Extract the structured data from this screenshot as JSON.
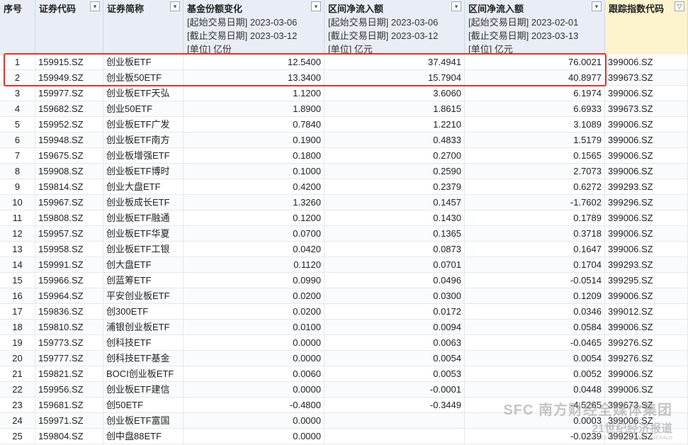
{
  "headers": [
    {
      "title": "序号",
      "lines": [],
      "filter": false,
      "highlight": false
    },
    {
      "title": "证券代码",
      "lines": [],
      "filter": true,
      "highlight": false
    },
    {
      "title": "证券简称",
      "lines": [],
      "filter": true,
      "highlight": false
    },
    {
      "title": "基金份额变化",
      "lines": [
        "[起始交易日期] 2023-03-06",
        "[截止交易日期] 2023-03-12",
        "[单位] 亿份"
      ],
      "filter": true,
      "highlight": false
    },
    {
      "title": "区间净流入额",
      "lines": [
        "[起始交易日期] 2023-03-06",
        "[截止交易日期] 2023-03-12",
        "[单位] 亿元"
      ],
      "filter": true,
      "highlight": false
    },
    {
      "title": "区间净流入额",
      "lines": [
        "[起始交易日期] 2023-02-01",
        "[截止交易日期] 2023-03-13",
        "[单位] 亿元"
      ],
      "filter": true,
      "highlight": false
    },
    {
      "title": "跟踪指数代码",
      "lines": [],
      "filter": true,
      "highlight": true
    }
  ],
  "rows": [
    [
      "1",
      "159915.SZ",
      "创业板ETF",
      "12.5400",
      "37.4941",
      "76.0021",
      "399006.SZ"
    ],
    [
      "2",
      "159949.SZ",
      "创业板50ETF",
      "13.3400",
      "15.7904",
      "40.8977",
      "399673.SZ"
    ],
    [
      "3",
      "159977.SZ",
      "创业板ETF天弘",
      "1.1200",
      "3.6060",
      "6.1974",
      "399006.SZ"
    ],
    [
      "4",
      "159682.SZ",
      "创业50ETF",
      "1.8900",
      "1.8615",
      "6.6933",
      "399673.SZ"
    ],
    [
      "5",
      "159952.SZ",
      "创业板ETF广发",
      "0.7840",
      "1.2210",
      "3.1089",
      "399006.SZ"
    ],
    [
      "6",
      "159948.SZ",
      "创业板ETF南方",
      "0.1900",
      "0.4833",
      "1.5179",
      "399006.SZ"
    ],
    [
      "7",
      "159675.SZ",
      "创业板增强ETF",
      "0.1800",
      "0.2700",
      "0.1565",
      "399006.SZ"
    ],
    [
      "8",
      "159908.SZ",
      "创业板ETF博时",
      "0.1000",
      "0.2590",
      "2.7073",
      "399006.SZ"
    ],
    [
      "9",
      "159814.SZ",
      "创业大盘ETF",
      "0.4200",
      "0.2379",
      "0.6272",
      "399293.SZ"
    ],
    [
      "10",
      "159967.SZ",
      "创业板成长ETF",
      "1.3260",
      "0.1457",
      "-1.7602",
      "399296.SZ"
    ],
    [
      "11",
      "159808.SZ",
      "创业板ETF融通",
      "0.1200",
      "0.1430",
      "0.1789",
      "399006.SZ"
    ],
    [
      "12",
      "159957.SZ",
      "创业板ETF华夏",
      "0.0700",
      "0.1365",
      "0.3718",
      "399006.SZ"
    ],
    [
      "13",
      "159958.SZ",
      "创业板ETF工银",
      "0.0420",
      "0.0873",
      "0.1647",
      "399006.SZ"
    ],
    [
      "14",
      "159991.SZ",
      "创大盘ETF",
      "0.1120",
      "0.0701",
      "0.1704",
      "399293.SZ"
    ],
    [
      "15",
      "159966.SZ",
      "创蓝筹ETF",
      "0.0990",
      "0.0496",
      "-0.0514",
      "399295.SZ"
    ],
    [
      "16",
      "159964.SZ",
      "平安创业板ETF",
      "0.0200",
      "0.0300",
      "0.1209",
      "399006.SZ"
    ],
    [
      "17",
      "159836.SZ",
      "创300ETF",
      "0.0200",
      "0.0172",
      "0.0346",
      "399012.SZ"
    ],
    [
      "18",
      "159810.SZ",
      "浦银创业板ETF",
      "0.0100",
      "0.0094",
      "0.0584",
      "399006.SZ"
    ],
    [
      "19",
      "159773.SZ",
      "创科技ETF",
      "0.0000",
      "0.0063",
      "-0.0465",
      "399276.SZ"
    ],
    [
      "20",
      "159777.SZ",
      "创科技ETF基金",
      "0.0000",
      "0.0054",
      "0.0054",
      "399276.SZ"
    ],
    [
      "21",
      "159821.SZ",
      "BOCI创业板ETF",
      "0.0060",
      "0.0053",
      "0.0052",
      "399006.SZ"
    ],
    [
      "22",
      "159956.SZ",
      "创业板ETF建信",
      "0.0000",
      "-0.0001",
      "0.0448",
      "399006.SZ"
    ],
    [
      "23",
      "159681.SZ",
      "创50ETF",
      "-0.4800",
      "-0.3449",
      "-4.5265",
      "399673.SZ"
    ],
    [
      "24",
      "159971.SZ",
      "创业板ETF富国",
      "0.0000",
      "",
      "0.0003",
      "399006.SZ"
    ],
    [
      "25",
      "159804.SZ",
      "创中盘88ETF",
      "0.0000",
      "",
      "-0.0239",
      "399291.SZ"
    ]
  ],
  "watermark": {
    "line1": "SFC 南方财经全媒体集团",
    "line2": "21世纪经济报道",
    "line3": "21st CENTURY BUSINESS HERALD"
  },
  "colors": {
    "highlight_border": "#e3332e",
    "header_bg": "#e9eef6",
    "tracking_header_bg": "#fdf3cf"
  }
}
